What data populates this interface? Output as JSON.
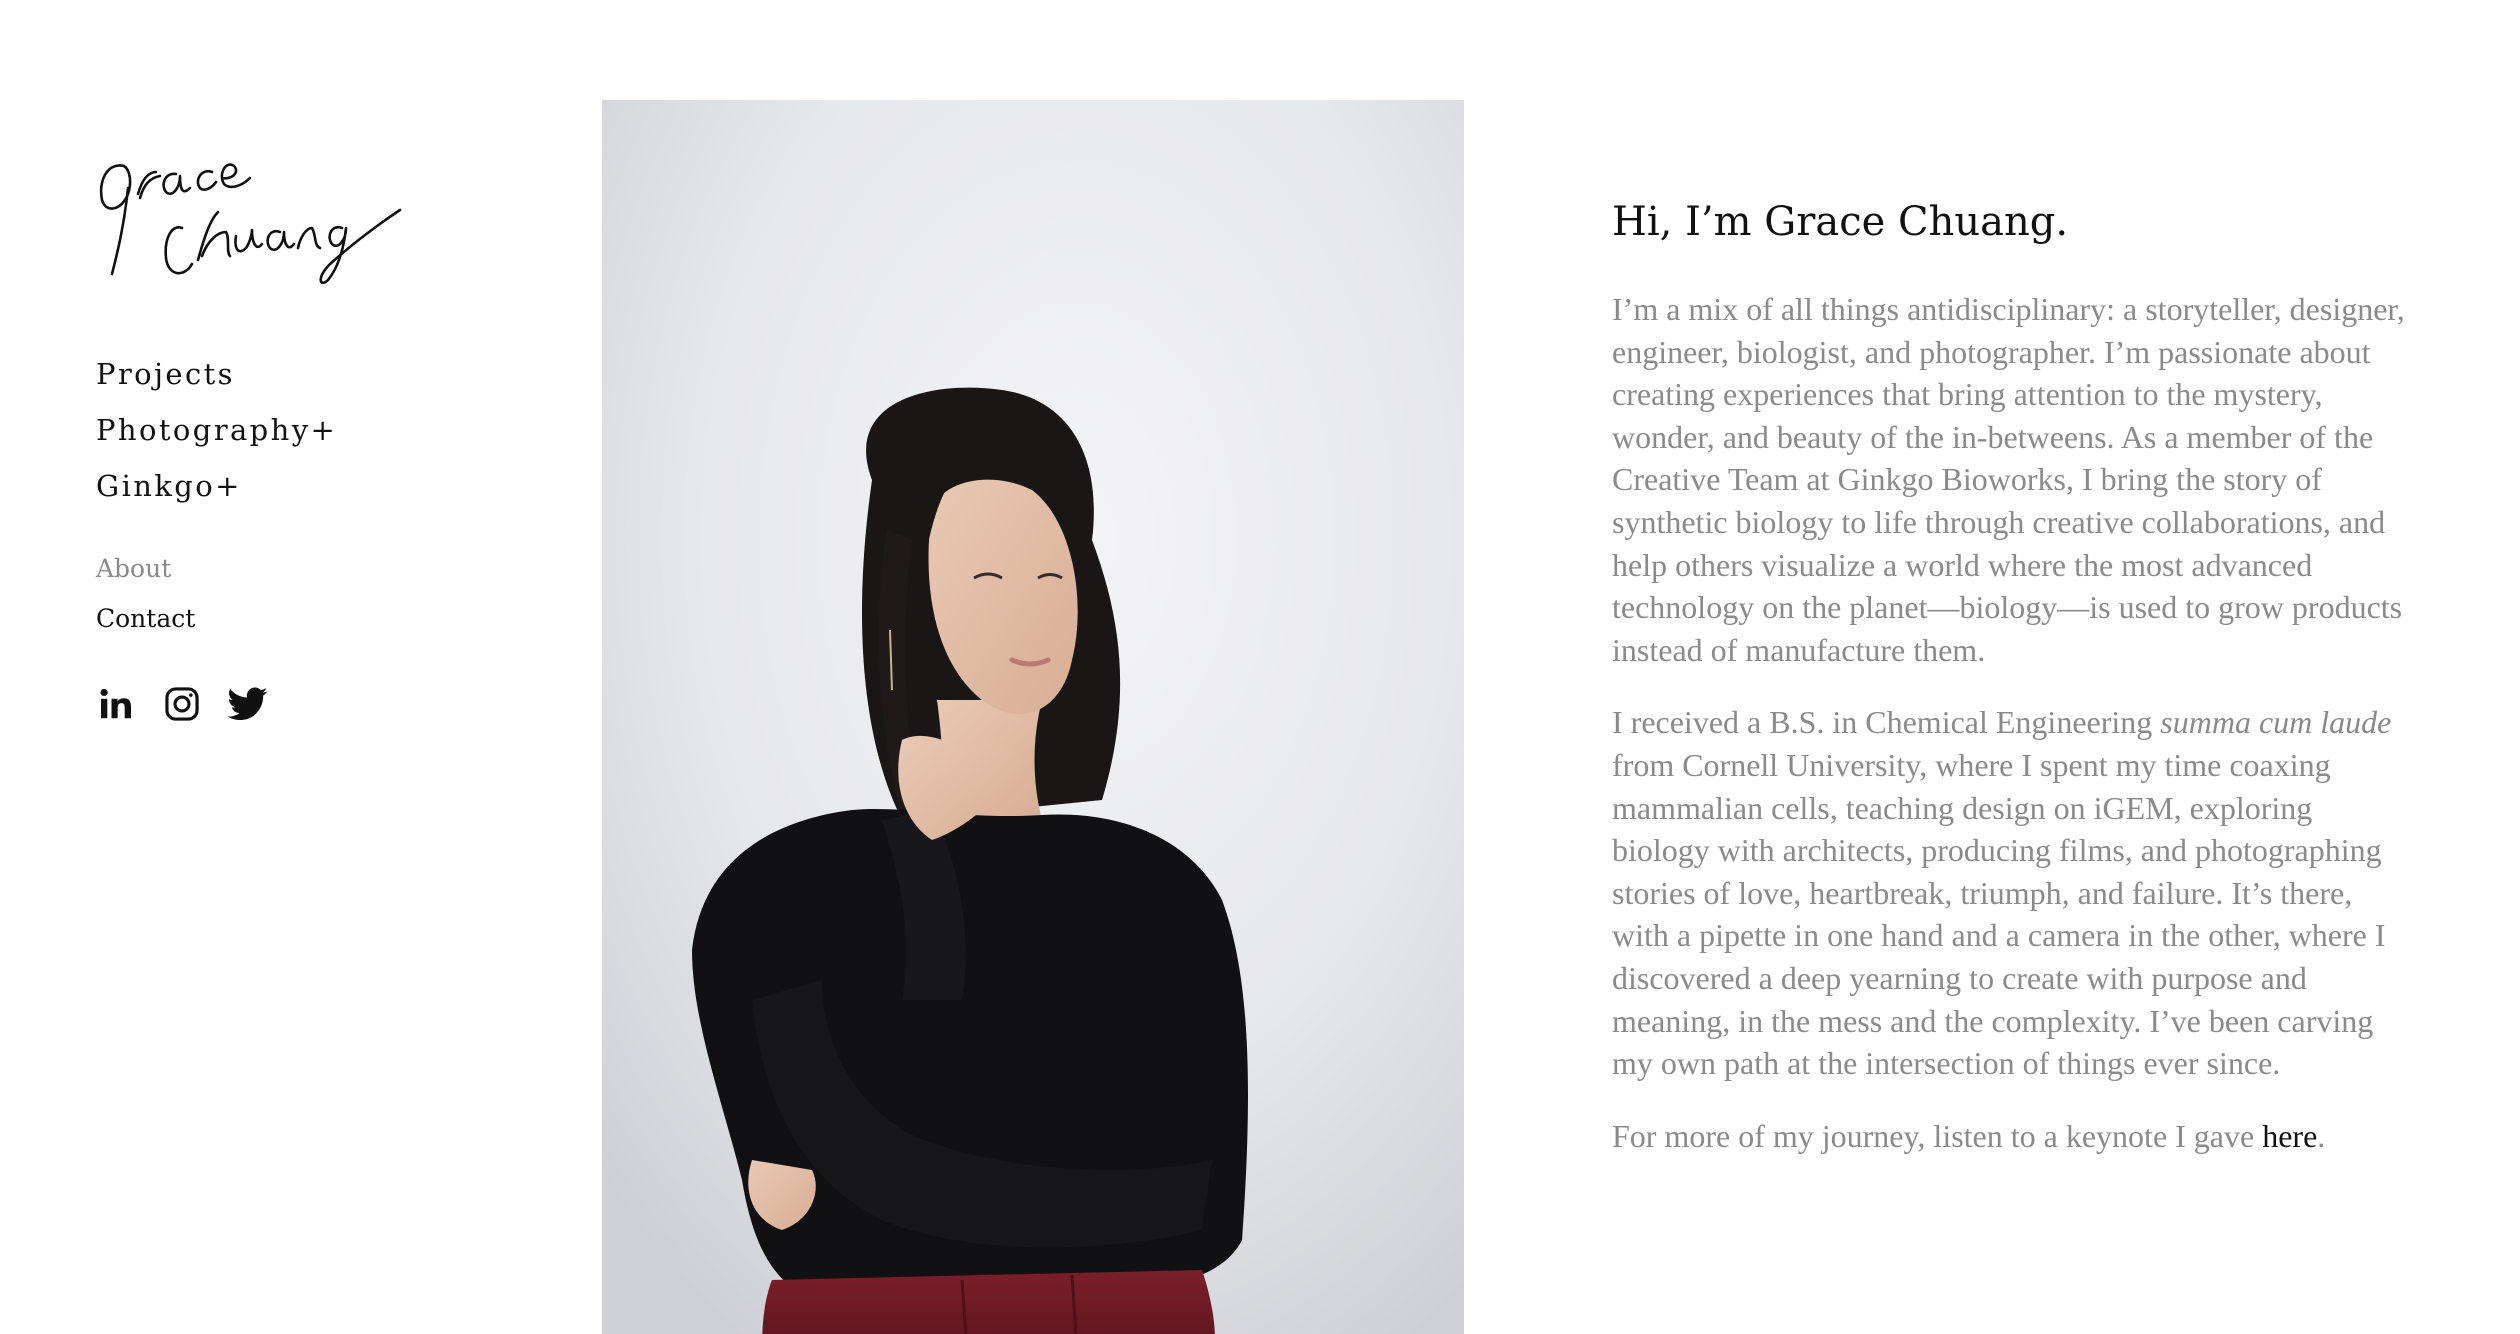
{
  "logo": {
    "text": "Grace Chuang"
  },
  "nav": {
    "primary": [
      "Projects",
      "Photography+",
      "Ginkgo+"
    ],
    "secondary": [
      "About",
      "Contact"
    ]
  },
  "social": {
    "icons": [
      "linkedin-icon",
      "instagram-icon",
      "twitter-icon"
    ]
  },
  "bio": {
    "heading": "Hi, I’m Grace Chuang.",
    "paragraph1": "I’m a mix of all things antidisciplinary: a storyteller, designer, engineer, biologist, and photographer. I’m passionate about creating experiences that bring attention to the mystery, wonder, and beauty of the in-betweens. As a member of the Creative Team at Ginkgo Bioworks, I bring the story of synthetic biology to life through creative collaborations, and help others visualize a world where the most advanced technology on the planet—biology—is used to grow products instead of manufacture them.",
    "paragraph2_part1": "I received a B.S. in Chemical Engineering ",
    "paragraph2_italic": "summa cum laude",
    "paragraph2_part2": " from Cornell University, where I spent my time coaxing mammalian cells, teaching design on iGEM, exploring biology with architects, producing films, and photographing stories of love, heartbreak, triumph, and failure. It’s there, with a pipette in one hand and a camera in the other, where I discovered a deep yearning to create with purpose and meaning, in the mess and the complexity. I’ve been carving my own path at the intersection of things ever since.",
    "paragraph3_prefix": "For more of my journey, listen to a keynote I gave ",
    "paragraph3_link": "here",
    "paragraph3_suffix": "."
  },
  "colors": {
    "text": "#111111",
    "muted": "#8a8a8a",
    "background": "#ffffff",
    "sweater": "#101012",
    "pants": "#6e1a22"
  }
}
